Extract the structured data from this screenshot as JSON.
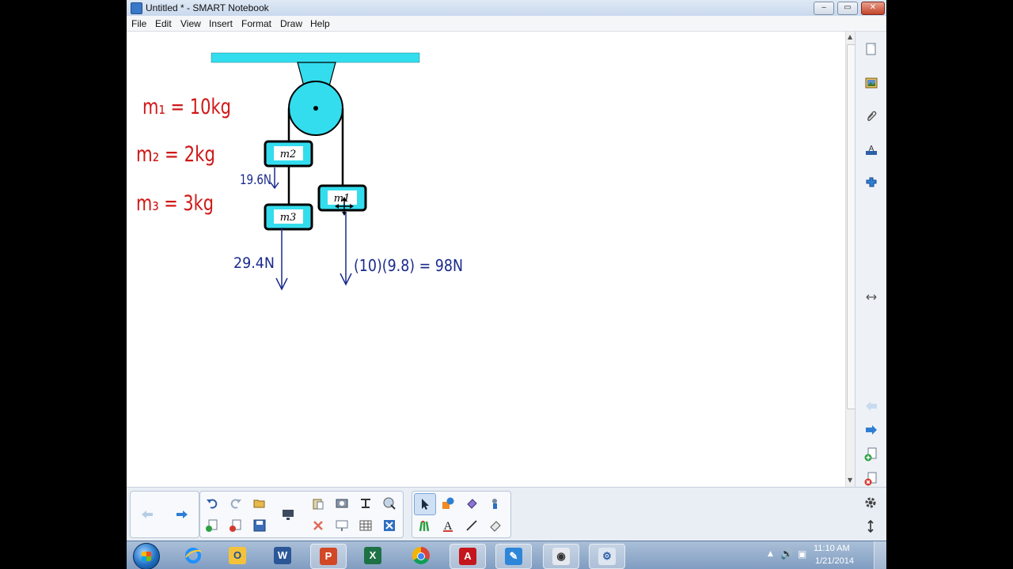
{
  "window": {
    "title": "Untitled * - SMART Notebook",
    "minimize": "‒",
    "maximize": "▭",
    "close": "✕"
  },
  "menu": [
    "File",
    "Edit",
    "View",
    "Insert",
    "Format",
    "Draw",
    "Help"
  ],
  "diagram": {
    "blocks": {
      "m1": "m1",
      "m2": "m2",
      "m3": "m3"
    },
    "givens": [
      "m₁ = 10kg",
      "m₂ = 2kg",
      "m₃ = 3kg"
    ],
    "forces": {
      "tension_m2": "19.6N",
      "weight_m3": "29.4N",
      "weight_m1": "(10)(9.8) = 98N"
    },
    "colors": {
      "rope": "#000000",
      "support": "#33ddee",
      "ink_red": "#d01818",
      "ink_blue": "#1a2b8c"
    }
  },
  "side_icons": [
    "page-sorter-icon",
    "gallery-icon",
    "attachments-icon",
    "properties-icon",
    "addons-icon",
    "expand-arrow-icon",
    "previous-page-icon",
    "next-page-icon",
    "add-page-icon",
    "delete-page-icon"
  ],
  "toolbar_icons": [
    "back-icon",
    "forward-icon",
    "undo-icon",
    "redo-icon",
    "open-icon",
    "add-page-icon",
    "delete-page-icon",
    "save-icon",
    "display-icon",
    "paste-icon",
    "screen-capture-icon",
    "screen-shade-icon",
    "full-screen-icon",
    "delete-icon",
    "shade-icon",
    "table-icon",
    "close-icon",
    "select-icon",
    "shapes-icon",
    "fill-icon",
    "magic-pen-icon",
    "pens-icon",
    "text-icon",
    "lines-icon",
    "eraser-icon",
    "settings-icon",
    "move-toolbar-icon"
  ],
  "taskbar": {
    "apps": [
      "Internet Explorer",
      "Outlook",
      "Word",
      "PowerPoint",
      "Excel",
      "Chrome",
      "Adobe Reader",
      "SMART Notebook",
      "Camera",
      "SMART Tools"
    ],
    "time": "11:10 AM",
    "date": "1/21/2014"
  }
}
